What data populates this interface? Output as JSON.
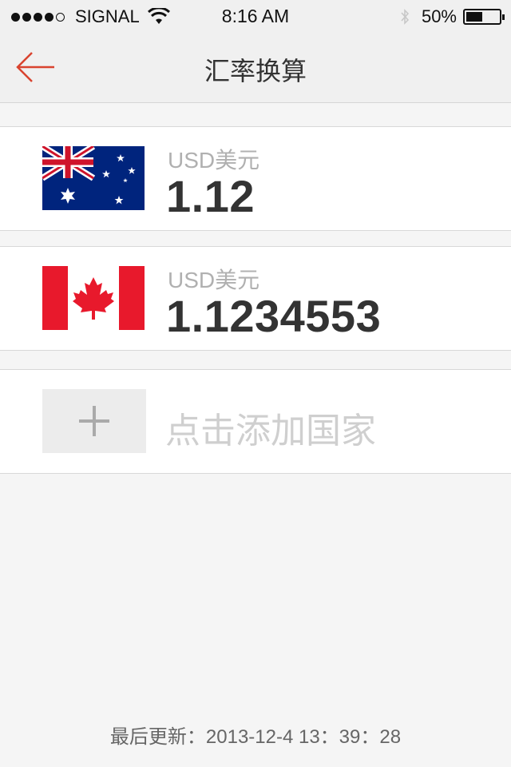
{
  "status_bar": {
    "carrier": "SIGNAL",
    "time": "8:16 AM",
    "battery_percent": "50%",
    "battery_level": 0.5,
    "signal_bars_filled": 4,
    "signal_bars_total": 5
  },
  "nav": {
    "title": "汇率换算",
    "back_icon": "arrow-left-icon",
    "accent_color": "#d9432f"
  },
  "rates": [
    {
      "currency_label": "USD美元",
      "value": "1.12",
      "flag": "australia-flag-icon"
    },
    {
      "currency_label": "USD美元",
      "value": "1.1234553",
      "flag": "canada-flag-icon"
    }
  ],
  "add_country": {
    "label": "点击添加国家",
    "icon": "plus-icon"
  },
  "footer": {
    "last_updated": "最后更新：2013-12-4 13：39：28"
  }
}
